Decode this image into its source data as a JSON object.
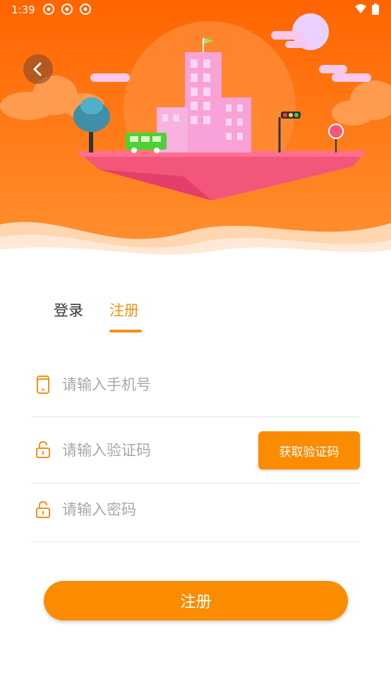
{
  "status_bar": {
    "time": "1:39",
    "left_icons": [
      "notification-icon",
      "notification-icon",
      "notification-icon"
    ],
    "right_icons": [
      "wifi-icon",
      "battery-icon"
    ]
  },
  "header": {
    "back_icon": "chevron-left-icon",
    "illustration_colors": {
      "sky_top": "#ff6a00",
      "sky_bottom": "#ff9a3c",
      "island": "#f2577a",
      "building": "#f8a2d8",
      "bus": "#4cd137"
    }
  },
  "tabs": [
    {
      "label": "登录",
      "active": false
    },
    {
      "label": "注册",
      "active": true
    }
  ],
  "form": {
    "phone": {
      "placeholder": "请输入手机号",
      "value": "",
      "icon": "phone-icon"
    },
    "code": {
      "placeholder": "请输入验证码",
      "value": "",
      "icon": "lock-icon",
      "button_label": "获取验证码"
    },
    "password": {
      "placeholder": "请输入密码",
      "value": "",
      "icon": "lock-icon"
    },
    "submit_label": "注册"
  },
  "colors": {
    "accent": "#fb8c00",
    "active_tab": "#f39216",
    "text": "#333333",
    "placeholder": "#a8a8a8",
    "divider": "#e6e6e6"
  }
}
